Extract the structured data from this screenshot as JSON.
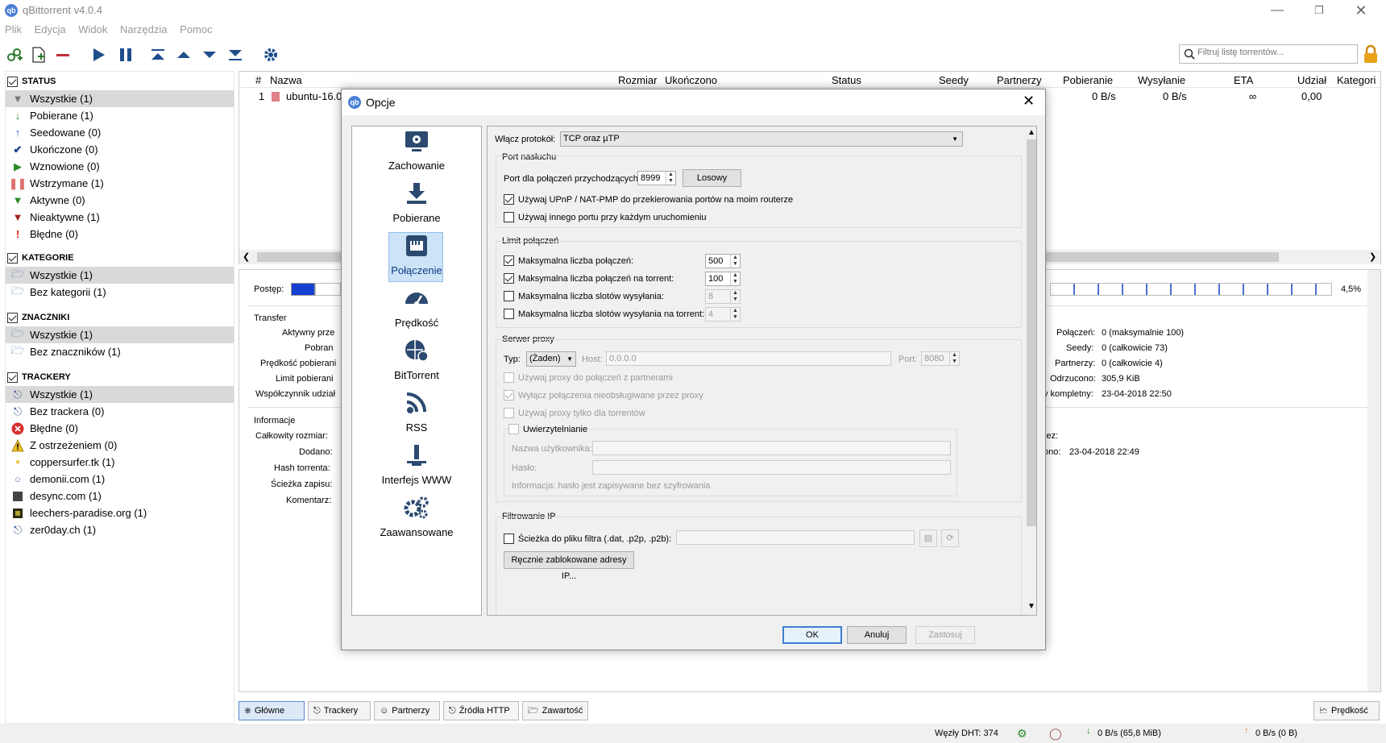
{
  "window": {
    "title": "qBittorrent v4.0.4",
    "app_icon": "qb"
  },
  "menu": [
    "Plik",
    "Edycja",
    "Widok",
    "Narzędzia",
    "Pomoc"
  ],
  "filter": {
    "placeholder": "Filtruj listę torrentów..."
  },
  "sidebar": {
    "status": {
      "header": "STATUS",
      "items": [
        "Wszystkie (1)",
        "Pobierane (1)",
        "Seedowane (0)",
        "Ukończone (0)",
        "Wznowione (0)",
        "Wstrzymane (1)",
        "Aktywne (0)",
        "Nieaktywne (1)",
        "Błędne (0)"
      ]
    },
    "categories": {
      "header": "KATEGORIE",
      "items": [
        "Wszystkie (1)",
        "Bez kategorii (1)"
      ]
    },
    "tags": {
      "header": "ZNACZNIKI",
      "items": [
        "Wszystkie (1)",
        "Bez znaczników (1)"
      ]
    },
    "trackers": {
      "header": "TRACKERY",
      "items": [
        "Wszystkie (1)",
        "Bez trackera (0)",
        "Błędne (0)",
        "Z ostrzeżeniem (0)",
        "coppersurfer.tk (1)",
        "demonii.com (1)",
        "desync.com (1)",
        "leechers-paradise.org (1)",
        "zer0day.ch (1)"
      ]
    }
  },
  "list": {
    "columns": [
      "#",
      "Nazwa",
      "Rozmiar",
      "Ukończono",
      "Status",
      "Seedy",
      "Partnerzy",
      "Pobieranie",
      "Wysyłanie",
      "ETA",
      "Udział",
      "Kategori"
    ],
    "row": {
      "num": "1",
      "name": "ubuntu-16.0",
      "download": "0 B/s",
      "upload": "0 B/s",
      "eta": "∞",
      "ratio": "0,00"
    }
  },
  "details": {
    "progress_label": "Postęp:",
    "progress_pct": "4,5%",
    "transfer_header": "Transfer",
    "transfer_labels": [
      "Aktywny prze",
      "Pobran",
      "Prędkość pobierani",
      "Limit pobierani",
      "Współczynnik udział"
    ],
    "info_header": "Informacje",
    "info_labels": [
      "Całkowity rozmiar:",
      "Dodano:",
      "Hash torrenta:",
      "Ścieżka zapisu:",
      "Komentarz:"
    ],
    "right_labels": [
      "Połączeń:",
      "Seedy:",
      "Partnerzy:",
      "Odrzucono:",
      "y kompletny:"
    ],
    "right_values": [
      "0 (maksymalnie 100)",
      "0 (całkowicie 73)",
      "0 (całkowicie 4)",
      "305,9 KiB",
      "23-04-2018 22:50"
    ],
    "right2_labels": [
      "zez:",
      "ono:"
    ],
    "right2_values": [
      "",
      "23-04-2018 22:49"
    ]
  },
  "bottom_tabs": [
    "Główne",
    "Trackery",
    "Partnerzy",
    "Źródła HTTP",
    "Zawartość"
  ],
  "speed_button": "Prędkość",
  "statusbar": {
    "dht": "Węzły DHT: 374",
    "down": "0 B/s (65,8 MiB)",
    "up": "0 B/s (0 B)"
  },
  "dialog": {
    "title": "Opcje",
    "nav": [
      "Zachowanie",
      "Pobierane",
      "Połączenie",
      "Prędkość",
      "BitTorrent",
      "RSS",
      "Interfejs WWW",
      "Zaawansowane"
    ],
    "protocol_label": "Włącz protokół:",
    "protocol_value": "TCP oraz µTP",
    "port": {
      "legend": "Port nasłuchu",
      "label": "Port dla połączeń przychodzących:",
      "value": "8999",
      "random_button": "Losowy",
      "upnp": "Używaj UPnP / NAT-PMP do przekierowania portów na moim routerze",
      "other_port": "Używaj innego portu przy każdym uruchomieniu"
    },
    "limits": {
      "legend": "Limit połączeń",
      "max_conn": "Maksymalna liczba połączeń:",
      "max_conn_value": "500",
      "max_conn_torrent": "Maksymalna liczba połączeń na torrent:",
      "max_conn_torrent_value": "100",
      "max_slots": "Maksymalna liczba slotów wysyłania:",
      "max_slots_value": "8",
      "max_slots_torrent": "Maksymalna liczba slotów wysyłania na torrent:",
      "max_slots_torrent_value": "4"
    },
    "proxy": {
      "legend": "Serwer proxy",
      "type_label": "Typ:",
      "type_value": "(Żaden)",
      "host_label": "Host:",
      "host_value": "0.0.0.0",
      "port_label": "Port:",
      "port_value": "8080",
      "peer": "Używaj proxy do połączeń z partnerami",
      "disable_unsupported": "Wyłącz połączenia nieobsługiwane przez proxy",
      "torrents_only": "Używaj proxy tylko dla torrentów",
      "auth": "Uwierzytelnianie",
      "user_label": "Nazwa użytkownika:",
      "pass_label": "Hasło:",
      "info": "Informacja: hasło jest zapisywane bez szyfrowania"
    },
    "ipfilter": {
      "legend": "Filtrowanie IP",
      "path_label": "Ścieżka do pliku filtra (.dat, .p2p, .p2b):",
      "manual_button": "Ręcznie zablokowane adresy IP..."
    },
    "buttons": {
      "ok": "OK",
      "cancel": "Anuluj",
      "apply": "Zastosuj"
    }
  }
}
